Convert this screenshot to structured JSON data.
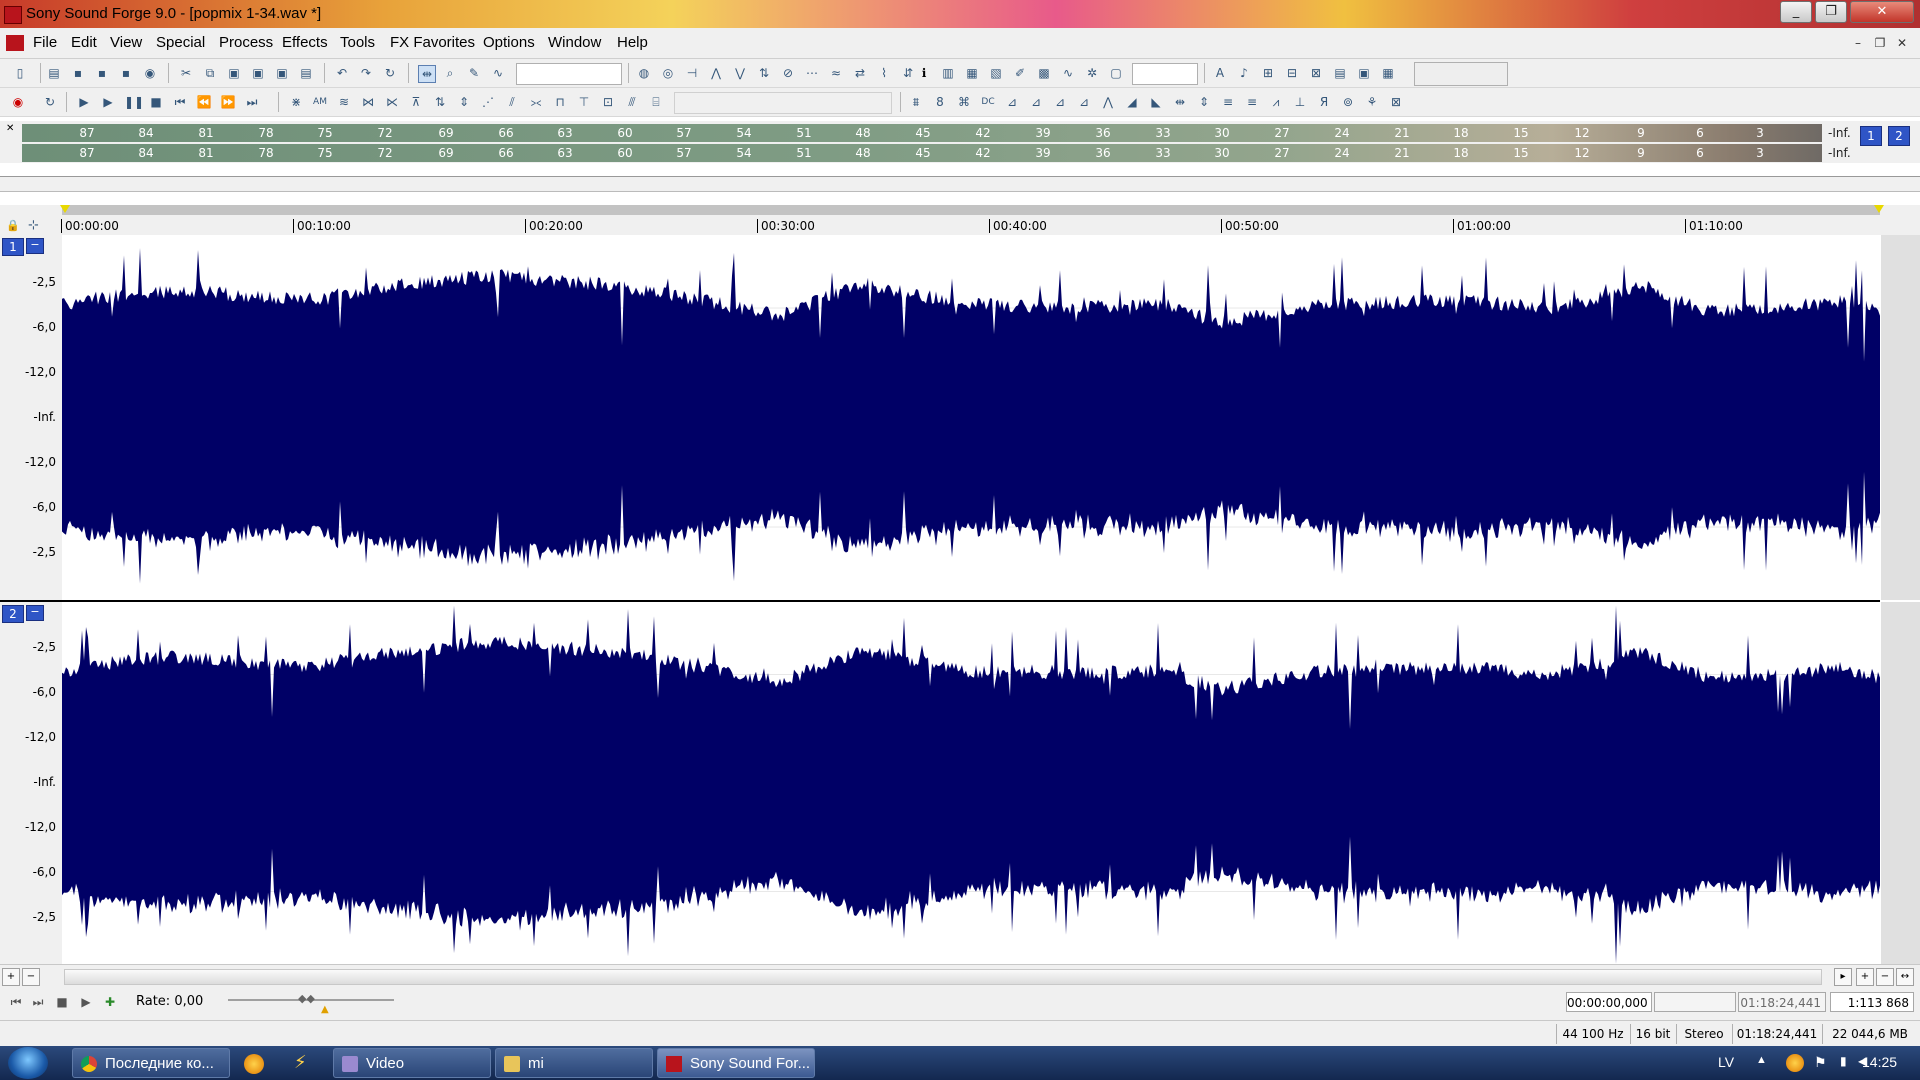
{
  "window": {
    "title": "Sony Sound Forge 9.0 - [popmix 1-34.wav *]"
  },
  "menu": [
    "File",
    "Edit",
    "View",
    "Special",
    "Process",
    "Effects",
    "Tools",
    "FX Favorites",
    "Options",
    "Window",
    "Help"
  ],
  "meters": {
    "scale": [
      "87",
      "84",
      "81",
      "78",
      "75",
      "72",
      "69",
      "66",
      "63",
      "60",
      "57",
      "54",
      "51",
      "48",
      "45",
      "42",
      "39",
      "36",
      "33",
      "30",
      "27",
      "24",
      "21",
      "18",
      "15",
      "12",
      "9",
      "6",
      "3"
    ],
    "ch1_readout": "-Inf.",
    "ch2_readout": "-Inf.",
    "channel_buttons": [
      "1",
      "2"
    ]
  },
  "timeline": [
    "00:00:00",
    "00:10:00",
    "00:20:00",
    "00:30:00",
    "00:40:00",
    "00:50:00",
    "01:00:00",
    "01:10:00"
  ],
  "channels": [
    {
      "number": "1",
      "collapse": "−",
      "db_labels": [
        "-2,5",
        "-6,0",
        "-12,0",
        "-Inf.",
        "-12,0",
        "-6,0",
        "-2,5"
      ]
    },
    {
      "number": "2",
      "collapse": "−",
      "db_labels": [
        "-2,5",
        "-6,0",
        "-12,0",
        "-Inf.",
        "-12,0",
        "-6,0",
        "-2,5"
      ]
    }
  ],
  "transport": {
    "rate_label": "Rate: 0,00",
    "selection_start": "00:00:00,000",
    "selection_end": "01:18:24,441",
    "zoom_ratio": "1:113 868"
  },
  "status": {
    "sample_rate": "44 100 Hz",
    "bit_depth": "16 bit",
    "channels": "Stereo",
    "length": "01:18:24,441",
    "file_size": "22 044,6 MB"
  },
  "taskbar": {
    "tasks": [
      "Последние ко...",
      "Video",
      "mi",
      "Sony Sound For..."
    ],
    "language": "LV",
    "clock": "14:25"
  },
  "colors": {
    "waveform": "#000066",
    "channel_badge": "#2f55c6"
  }
}
